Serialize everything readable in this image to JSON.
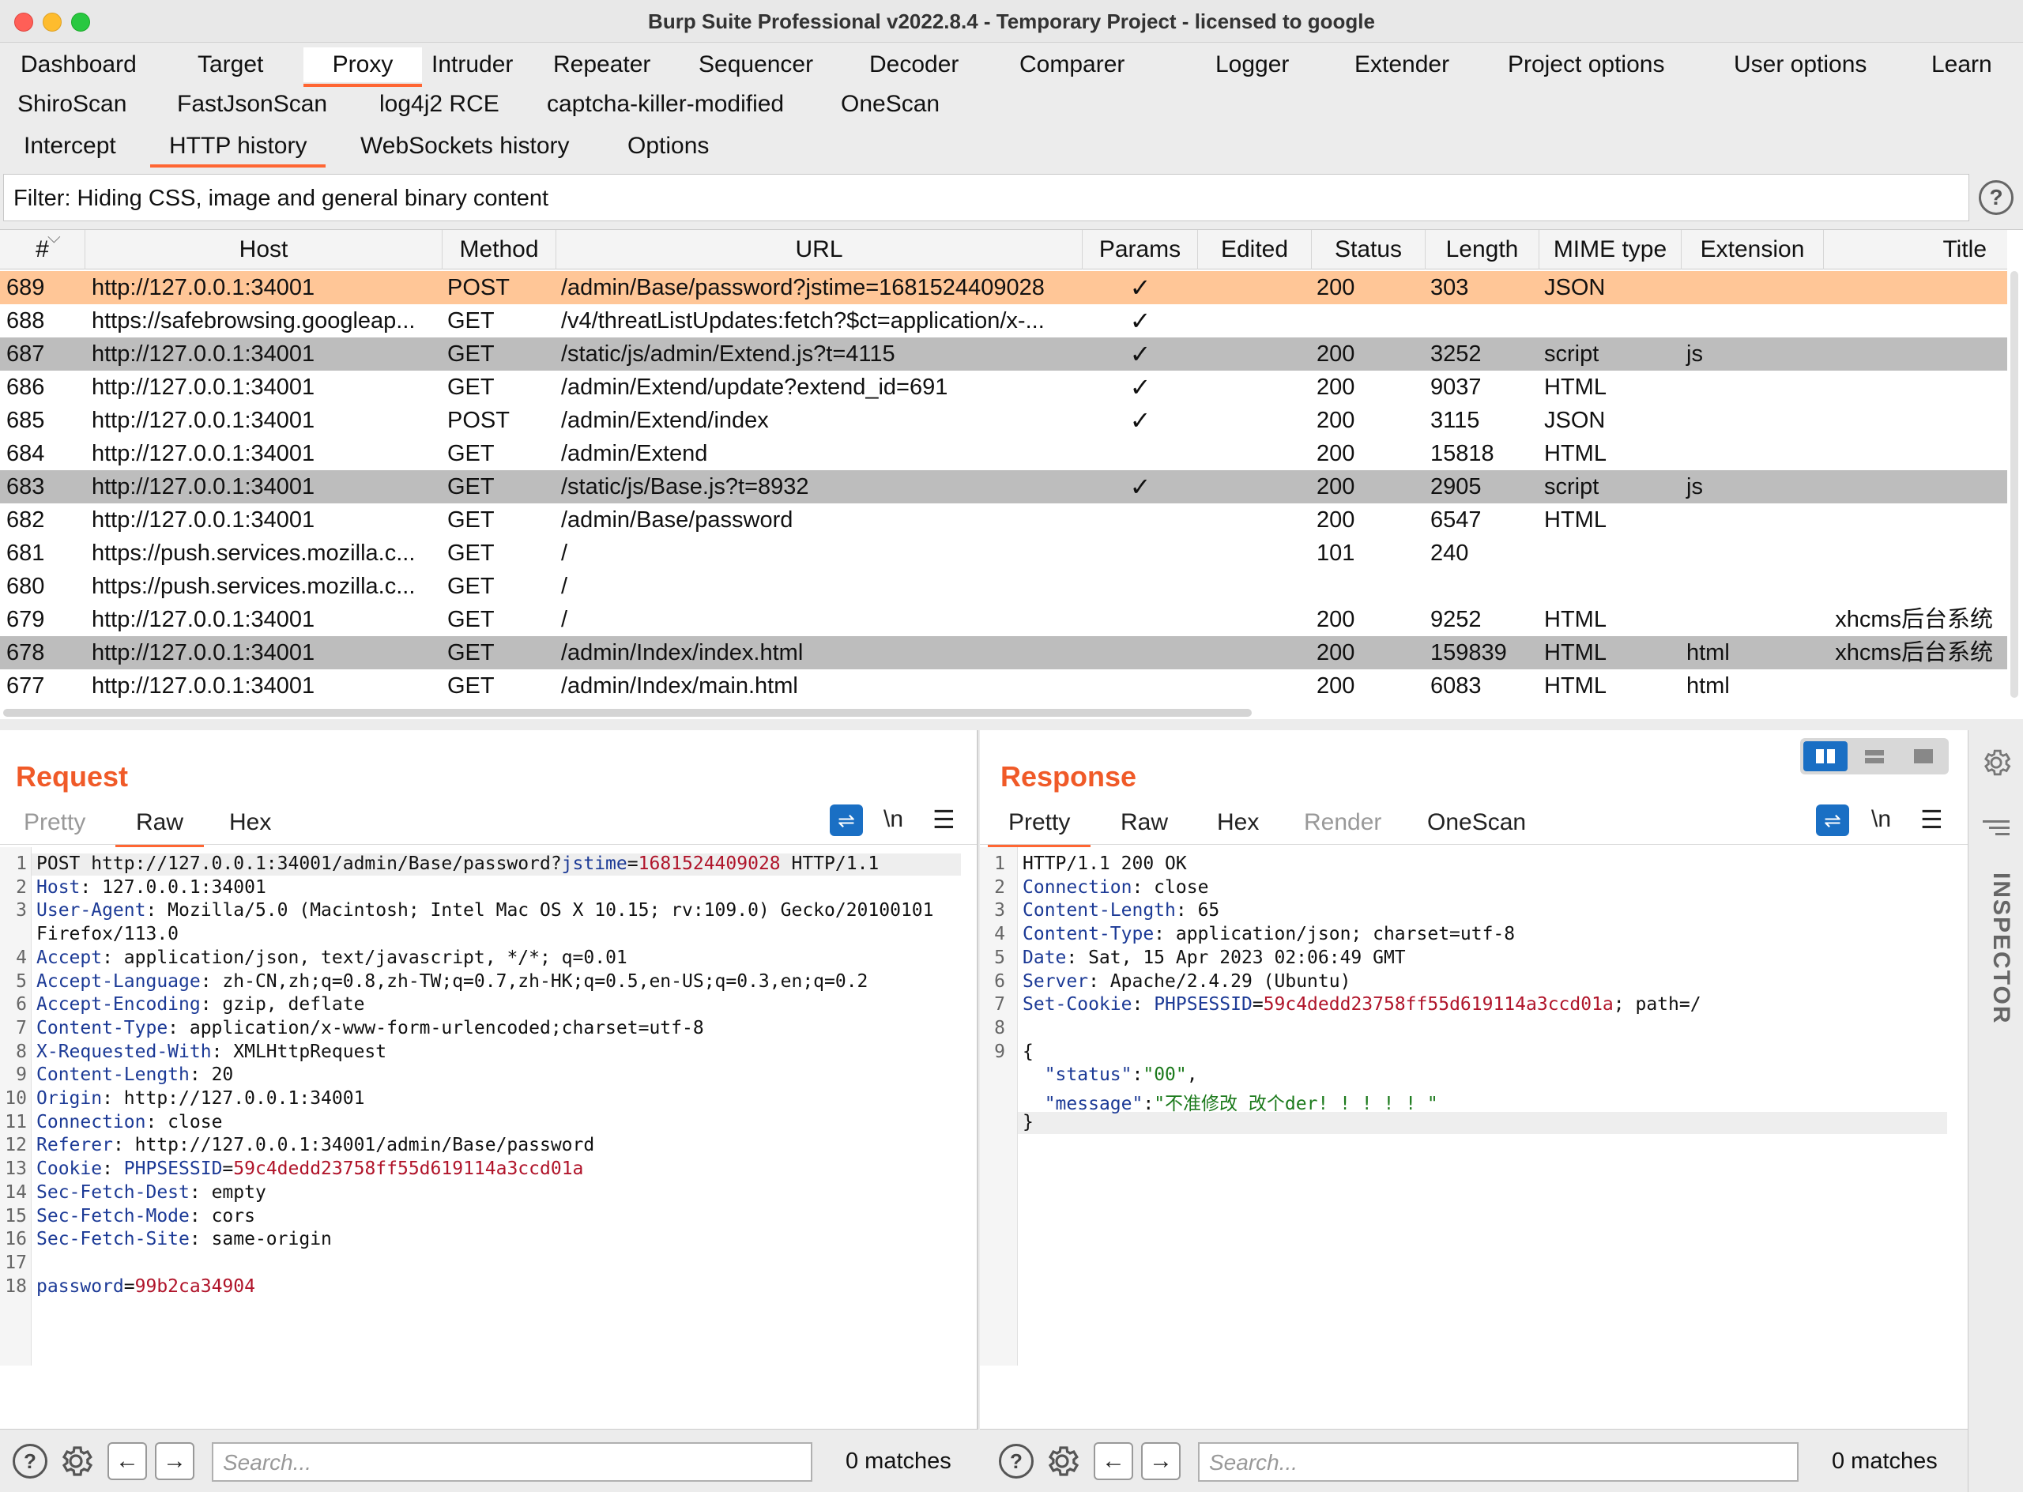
{
  "window": {
    "title": "Burp Suite Professional v2022.8.4 - Temporary Project - licensed to google"
  },
  "main_tabs": {
    "row1": [
      "Dashboard",
      "Target",
      "Proxy",
      "Intruder",
      "Repeater",
      "Sequencer",
      "Decoder",
      "Comparer",
      "Logger",
      "Extender",
      "Project options",
      "User options",
      "Learn"
    ],
    "row2": [
      "ShiroScan",
      "FastJsonScan",
      "log4j2 RCE",
      "captcha-killer-modified",
      "OneScan"
    ],
    "active": "Proxy"
  },
  "sub_tabs": {
    "items": [
      "Intercept",
      "HTTP history",
      "WebSockets history",
      "Options"
    ],
    "active": "HTTP history"
  },
  "filter": {
    "text": "Filter: Hiding CSS, image and general binary content",
    "help": "?"
  },
  "table": {
    "columns": [
      "#",
      "Host",
      "Method",
      "URL",
      "Params",
      "Edited",
      "Status",
      "Length",
      "MIME type",
      "Extension",
      "Title"
    ],
    "rows": [
      {
        "num": "689",
        "host": "http://127.0.0.1:34001",
        "method": "POST",
        "url": "/admin/Base/password?jstime=1681524409028",
        "params": "✓",
        "edited": "",
        "status": "200",
        "length": "303",
        "mime": "JSON",
        "ext": "",
        "title": ""
      },
      {
        "num": "688",
        "host": "https://safebrowsing.googleap...",
        "method": "GET",
        "url": "/v4/threatListUpdates:fetch?$ct=application/x-...",
        "params": "✓",
        "edited": "",
        "status": "",
        "length": "",
        "mime": "",
        "ext": "",
        "title": ""
      },
      {
        "num": "687",
        "host": "http://127.0.0.1:34001",
        "method": "GET",
        "url": "/static/js/admin/Extend.js?t=4115",
        "params": "✓",
        "edited": "",
        "status": "200",
        "length": "3252",
        "mime": "script",
        "ext": "js",
        "title": ""
      },
      {
        "num": "686",
        "host": "http://127.0.0.1:34001",
        "method": "GET",
        "url": "/admin/Extend/update?extend_id=691",
        "params": "✓",
        "edited": "",
        "status": "200",
        "length": "9037",
        "mime": "HTML",
        "ext": "",
        "title": ""
      },
      {
        "num": "685",
        "host": "http://127.0.0.1:34001",
        "method": "POST",
        "url": "/admin/Extend/index",
        "params": "✓",
        "edited": "",
        "status": "200",
        "length": "3115",
        "mime": "JSON",
        "ext": "",
        "title": ""
      },
      {
        "num": "684",
        "host": "http://127.0.0.1:34001",
        "method": "GET",
        "url": "/admin/Extend",
        "params": "",
        "edited": "",
        "status": "200",
        "length": "15818",
        "mime": "HTML",
        "ext": "",
        "title": ""
      },
      {
        "num": "683",
        "host": "http://127.0.0.1:34001",
        "method": "GET",
        "url": "/static/js/Base.js?t=8932",
        "params": "✓",
        "edited": "",
        "status": "200",
        "length": "2905",
        "mime": "script",
        "ext": "js",
        "title": ""
      },
      {
        "num": "682",
        "host": "http://127.0.0.1:34001",
        "method": "GET",
        "url": "/admin/Base/password",
        "params": "",
        "edited": "",
        "status": "200",
        "length": "6547",
        "mime": "HTML",
        "ext": "",
        "title": ""
      },
      {
        "num": "681",
        "host": "https://push.services.mozilla.c...",
        "method": "GET",
        "url": "/",
        "params": "",
        "edited": "",
        "status": "101",
        "length": "240",
        "mime": "",
        "ext": "",
        "title": ""
      },
      {
        "num": "680",
        "host": "https://push.services.mozilla.c...",
        "method": "GET",
        "url": "/",
        "params": "",
        "edited": "",
        "status": "",
        "length": "",
        "mime": "",
        "ext": "",
        "title": ""
      },
      {
        "num": "679",
        "host": "http://127.0.0.1:34001",
        "method": "GET",
        "url": "/",
        "params": "",
        "edited": "",
        "status": "200",
        "length": "9252",
        "mime": "HTML",
        "ext": "",
        "title": "xhcms后台系统"
      },
      {
        "num": "678",
        "host": "http://127.0.0.1:34001",
        "method": "GET",
        "url": "/admin/Index/index.html",
        "params": "",
        "edited": "",
        "status": "200",
        "length": "159839",
        "mime": "HTML",
        "ext": "html",
        "title": "xhcms后台系统"
      },
      {
        "num": "677",
        "host": "http://127.0.0.1:34001",
        "method": "GET",
        "url": "/admin/Index/main.html",
        "params": "",
        "edited": "",
        "status": "200",
        "length": "6083",
        "mime": "HTML",
        "ext": "html",
        "title": ""
      }
    ]
  },
  "request": {
    "title": "Request",
    "tabs": [
      "Pretty",
      "Raw",
      "Hex"
    ],
    "active_tab": "Raw",
    "newline_label": "\\n",
    "lines": [
      [
        "1",
        [
          [
            "",
            "POST http://127.0.0.1:34001/admin/Base/password?"
          ],
          [
            "k",
            "jstime"
          ],
          [
            "",
            "="
          ],
          [
            "v",
            "1681524409028"
          ],
          [
            "",
            " HTTP/1.1"
          ]
        ]
      ],
      [
        "2",
        [
          [
            "k",
            "Host"
          ],
          [
            "",
            ": 127.0.0.1:34001"
          ]
        ]
      ],
      [
        "3",
        [
          [
            "k",
            "User-Agent"
          ],
          [
            "",
            ": Mozilla/5.0 (Macintosh; Intel Mac OS X 10.15; rv:109.0) Gecko/20100101"
          ]
        ]
      ],
      [
        "",
        [
          [
            "",
            "Firefox/113.0"
          ]
        ]
      ],
      [
        "4",
        [
          [
            "k",
            "Accept"
          ],
          [
            "",
            ": application/json, text/javascript, */*; q=0.01"
          ]
        ]
      ],
      [
        "5",
        [
          [
            "k",
            "Accept-Language"
          ],
          [
            "",
            ": zh-CN,zh;q=0.8,zh-TW;q=0.7,zh-HK;q=0.5,en-US;q=0.3,en;q=0.2"
          ]
        ]
      ],
      [
        "6",
        [
          [
            "k",
            "Accept-Encoding"
          ],
          [
            "",
            ": gzip, deflate"
          ]
        ]
      ],
      [
        "7",
        [
          [
            "k",
            "Content-Type"
          ],
          [
            "",
            ": application/x-www-form-urlencoded;charset=utf-8"
          ]
        ]
      ],
      [
        "8",
        [
          [
            "k",
            "X-Requested-With"
          ],
          [
            "",
            ": XMLHttpRequest"
          ]
        ]
      ],
      [
        "9",
        [
          [
            "k",
            "Content-Length"
          ],
          [
            "",
            ": 20"
          ]
        ]
      ],
      [
        "10",
        [
          [
            "k",
            "Origin"
          ],
          [
            "",
            ": http://127.0.0.1:34001"
          ]
        ]
      ],
      [
        "11",
        [
          [
            "k",
            "Connection"
          ],
          [
            "",
            ": close"
          ]
        ]
      ],
      [
        "12",
        [
          [
            "k",
            "Referer"
          ],
          [
            "",
            ": http://127.0.0.1:34001/admin/Base/password"
          ]
        ]
      ],
      [
        "13",
        [
          [
            "k",
            "Cookie"
          ],
          [
            "",
            ": "
          ],
          [
            "k",
            "PHPSESSID"
          ],
          [
            "",
            "="
          ],
          [
            "v",
            "59c4dedd23758ff55d619114a3ccd01a"
          ]
        ]
      ],
      [
        "14",
        [
          [
            "k",
            "Sec-Fetch-Dest"
          ],
          [
            "",
            ": empty"
          ]
        ]
      ],
      [
        "15",
        [
          [
            "k",
            "Sec-Fetch-Mode"
          ],
          [
            "",
            ": cors"
          ]
        ]
      ],
      [
        "16",
        [
          [
            "k",
            "Sec-Fetch-Site"
          ],
          [
            "",
            ": same-origin"
          ]
        ]
      ],
      [
        "17",
        []
      ],
      [
        "18",
        [
          [
            "k",
            "password"
          ],
          [
            "",
            "="
          ],
          [
            "v",
            "99b2ca34904"
          ]
        ]
      ]
    ],
    "search_placeholder": "Search...",
    "matches": "0 matches"
  },
  "response": {
    "title": "Response",
    "tabs": [
      "Pretty",
      "Raw",
      "Hex",
      "Render",
      "OneScan"
    ],
    "active_tab": "Pretty",
    "newline_label": "\\n",
    "lines": [
      [
        "1",
        [
          [
            "",
            "HTTP/1.1 200 OK"
          ]
        ]
      ],
      [
        "2",
        [
          [
            "k",
            "Connection"
          ],
          [
            "",
            ": close"
          ]
        ]
      ],
      [
        "3",
        [
          [
            "k",
            "Content-Length"
          ],
          [
            "",
            ": 65"
          ]
        ]
      ],
      [
        "4",
        [
          [
            "k",
            "Content-Type"
          ],
          [
            "",
            ": application/json; charset=utf-8"
          ]
        ]
      ],
      [
        "5",
        [
          [
            "k",
            "Date"
          ],
          [
            "",
            ": Sat, 15 Apr 2023 02:06:49 GMT"
          ]
        ]
      ],
      [
        "6",
        [
          [
            "k",
            "Server"
          ],
          [
            "",
            ": Apache/2.4.29 (Ubuntu)"
          ]
        ]
      ],
      [
        "7",
        [
          [
            "k",
            "Set-Cookie"
          ],
          [
            "",
            ": "
          ],
          [
            "k",
            "PHPSESSID"
          ],
          [
            "",
            "="
          ],
          [
            "v",
            "59c4dedd23758ff55d619114a3ccd01a"
          ],
          [
            "",
            "; path=/"
          ]
        ]
      ],
      [
        "8",
        []
      ],
      [
        "9",
        [
          [
            "",
            "{"
          ]
        ]
      ],
      [
        "",
        [
          [
            "",
            "  "
          ],
          [
            "k",
            "\"status\""
          ],
          [
            "",
            ":"
          ],
          [
            "g",
            "\"00\""
          ],
          [
            "",
            ","
          ]
        ]
      ],
      [
        "",
        [
          [
            "",
            "  "
          ],
          [
            "k",
            "\"message\""
          ],
          [
            "",
            ":"
          ],
          [
            "g",
            "\"不准修改 改个der! ! ! ! ! \""
          ]
        ]
      ],
      [
        "",
        [
          [
            "",
            "}"
          ]
        ]
      ]
    ],
    "search_placeholder": "Search...",
    "matches": "0 matches"
  },
  "inspector": {
    "label": "INSPECTOR"
  },
  "colors": {
    "accent": "#ff6633",
    "selected_row": "#ffc697",
    "highlighted_row": "#bdbdbd",
    "key": "#1c3a96",
    "value": "#b0142a"
  }
}
